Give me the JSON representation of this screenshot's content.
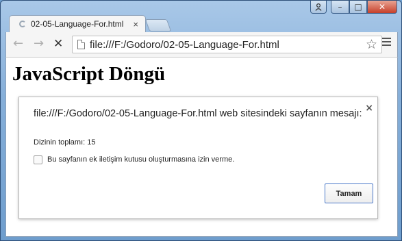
{
  "window": {
    "caption_buttons": {
      "user_icon": "user-icon",
      "min": "–",
      "max": "□",
      "close": "✕"
    }
  },
  "tab": {
    "title": "02-05-Language-For.html",
    "close": "×"
  },
  "toolbar": {
    "back": "←",
    "forward": "→",
    "stop": "✕",
    "url": "file:///F:/Godoro/02-05-Language-For.html",
    "star": "☆"
  },
  "page": {
    "heading": "JavaScript Döngü"
  },
  "dialog": {
    "title": "file:///F:/Godoro/02-05-Language-For.html web sitesindeki sayfanın mesajı:",
    "close": "×",
    "message": "Dizinin toplamı: 15",
    "checkbox_label": "Bu sayfanın ek iletişim kutusu oluşturmasına izin verme.",
    "ok_label": "Tamam"
  }
}
